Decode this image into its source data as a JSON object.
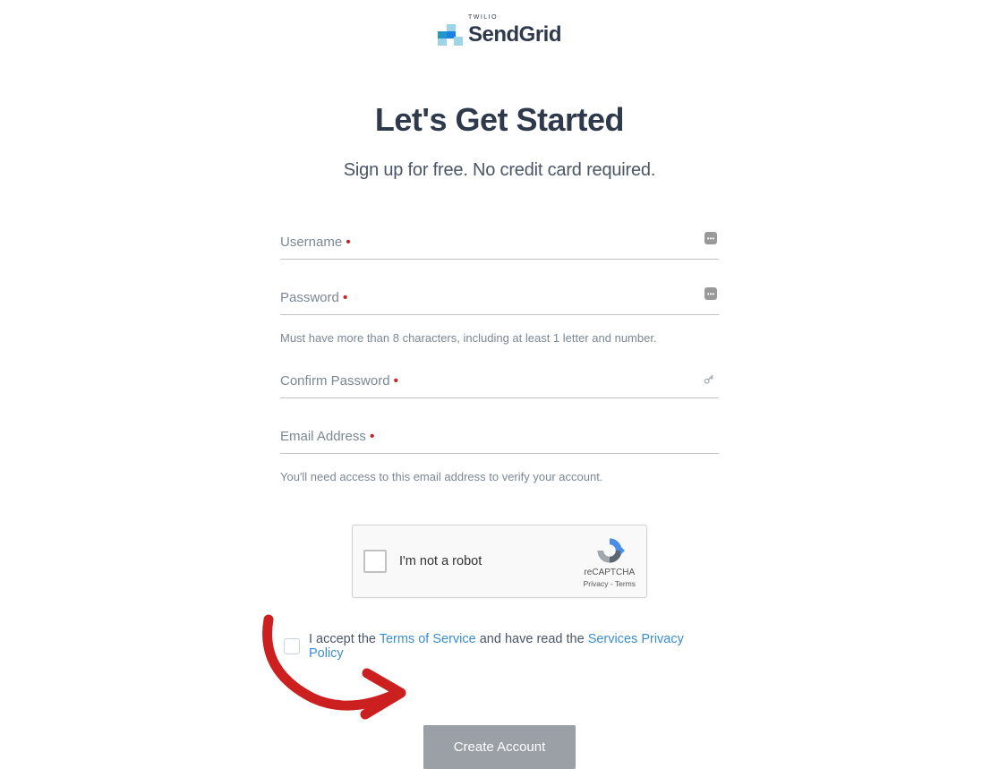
{
  "logo": {
    "brand_small": "TWILIO",
    "brand_main": "SendGrid"
  },
  "heading": "Let's Get Started",
  "subheading": "Sign up for free. No credit card required.",
  "form": {
    "username": {
      "label": "Username",
      "value": ""
    },
    "password": {
      "label": "Password",
      "value": "",
      "hint": "Must have more than 8 characters, including at least 1 letter and number."
    },
    "confirm_password": {
      "label": "Confirm Password",
      "value": ""
    },
    "email": {
      "label": "Email Address",
      "value": "",
      "hint": "You'll need access to this email address to verify your account."
    }
  },
  "recaptcha": {
    "label": "I'm not a robot",
    "brand": "reCAPTCHA",
    "links": "Privacy - Terms"
  },
  "tos": {
    "prefix": "I accept the ",
    "terms_link": "Terms of Service",
    "middle": " and have read the ",
    "privacy_link": "Services Privacy Policy"
  },
  "submit_label": "Create Account"
}
